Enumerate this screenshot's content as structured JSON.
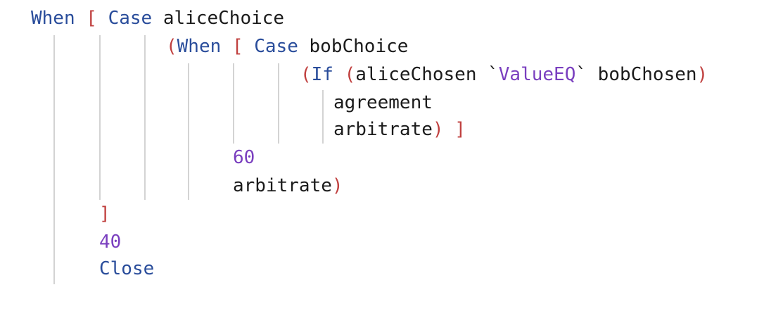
{
  "code": {
    "lines": [
      [
        {
          "text": "When",
          "kind": "kw"
        },
        {
          "text": " ",
          "kind": "id"
        },
        {
          "text": "[",
          "kind": "br"
        },
        {
          "text": " ",
          "kind": "id"
        },
        {
          "text": "Case",
          "kind": "kw"
        },
        {
          "text": " aliceChoice",
          "kind": "id"
        }
      ],
      [
        {
          "text": "(",
          "kind": "br"
        },
        {
          "text": "When",
          "kind": "kw"
        },
        {
          "text": " ",
          "kind": "id"
        },
        {
          "text": "[",
          "kind": "br"
        },
        {
          "text": " ",
          "kind": "id"
        },
        {
          "text": "Case",
          "kind": "kw"
        },
        {
          "text": " bobChoice",
          "kind": "id"
        }
      ],
      [
        {
          "text": "(",
          "kind": "br"
        },
        {
          "text": "If",
          "kind": "kw"
        },
        {
          "text": " ",
          "kind": "id"
        },
        {
          "text": "(",
          "kind": "br"
        },
        {
          "text": "aliceChosen `",
          "kind": "id"
        },
        {
          "text": "ValueEQ",
          "kind": "op"
        },
        {
          "text": "` bobChosen",
          "kind": "id"
        },
        {
          "text": ")",
          "kind": "br"
        }
      ],
      [
        {
          "text": "agreement",
          "kind": "id"
        }
      ],
      [
        {
          "text": "arbitrate",
          "kind": "id"
        },
        {
          "text": ")",
          "kind": "br"
        },
        {
          "text": " ",
          "kind": "id"
        },
        {
          "text": "]",
          "kind": "br"
        }
      ],
      [
        {
          "text": "60",
          "kind": "num"
        }
      ],
      [
        {
          "text": "arbitrate",
          "kind": "id"
        },
        {
          "text": ")",
          "kind": "br"
        }
      ],
      [
        {
          "text": "]",
          "kind": "br"
        }
      ],
      [
        {
          "text": "40",
          "kind": "num"
        }
      ],
      [
        {
          "text": "Close",
          "kind": "kw"
        }
      ]
    ]
  },
  "colors": {
    "keyword": "#2a4d9b",
    "bracket": "#c0403f",
    "number": "#7a3fbf",
    "identifier": "#1b1b1b",
    "guide": "#d3d3d3",
    "background": "#ffffff"
  }
}
